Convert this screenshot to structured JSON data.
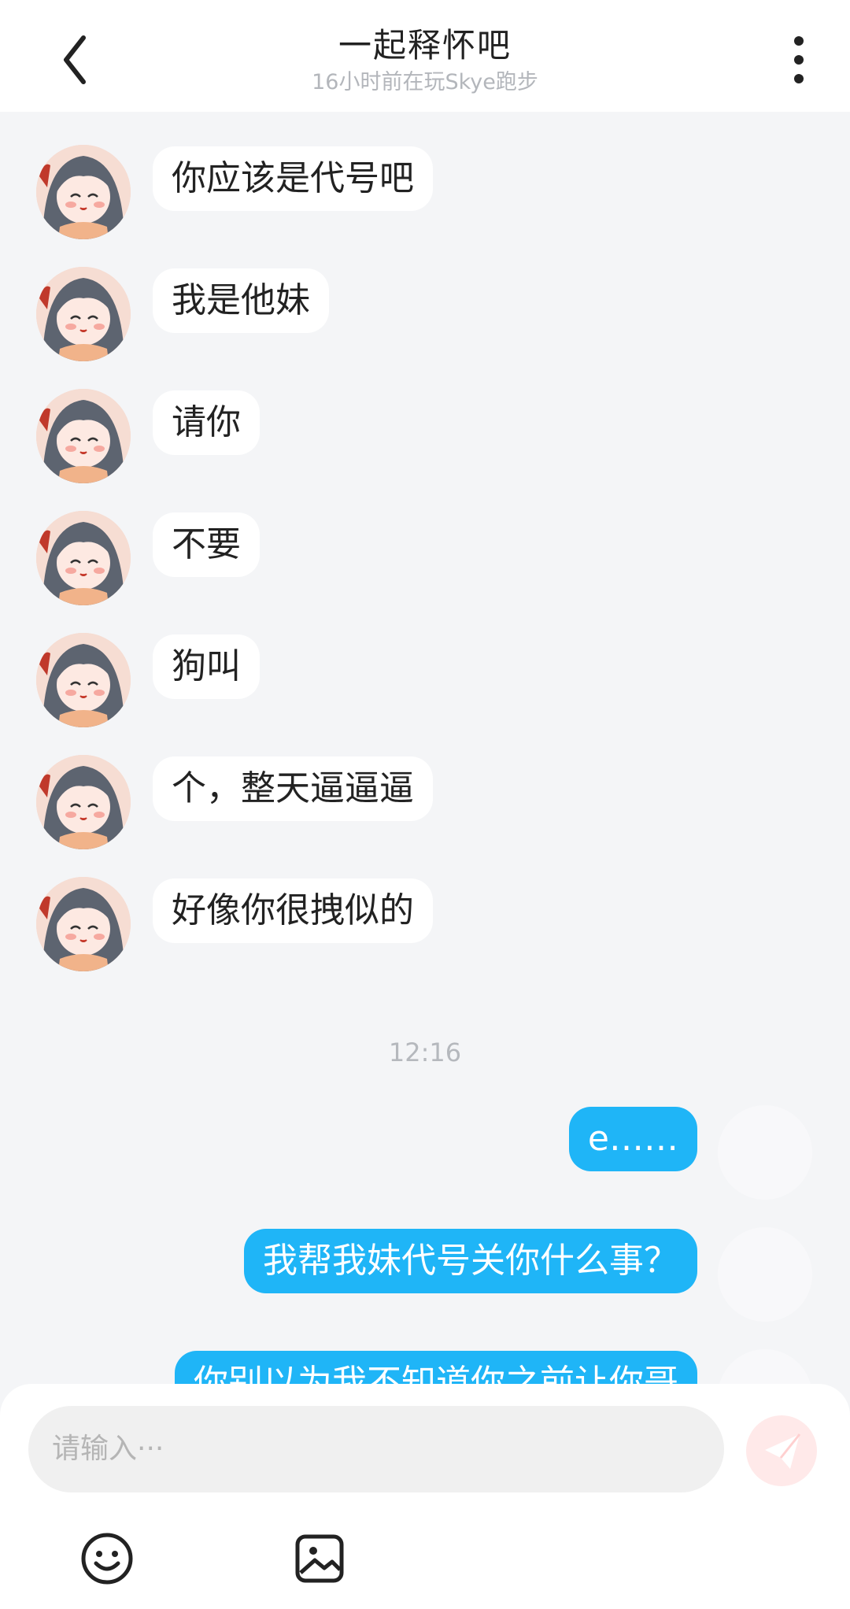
{
  "header": {
    "title": "一起释怀吧",
    "subtitle": "16小时前在玩Skye跑步"
  },
  "messages_in": [
    {
      "text": "你应该是代号吧"
    },
    {
      "text": "我是他妹"
    },
    {
      "text": "请你"
    },
    {
      "text": "不要"
    },
    {
      "text": "狗叫"
    },
    {
      "text": "个，整天逼逼逼"
    },
    {
      "text": "好像你很拽似的"
    }
  ],
  "timestamp": "12:16",
  "messages_out": [
    {
      "text": "e……"
    },
    {
      "text": "我帮我妹代号关你什么事？"
    },
    {
      "text": "你别以为我不知道你之前让你哥"
    }
  ],
  "input": {
    "placeholder": "请输入···"
  },
  "icons": {
    "back": "chevron-left-icon",
    "more": "more-vertical-icon",
    "send": "paper-plane-icon",
    "emoji": "emoji-icon",
    "image": "image-icon"
  },
  "colors": {
    "accent_bubble": "#1fb5f7",
    "send_button": "#ffe9e9",
    "background": "#f4f5f7"
  }
}
